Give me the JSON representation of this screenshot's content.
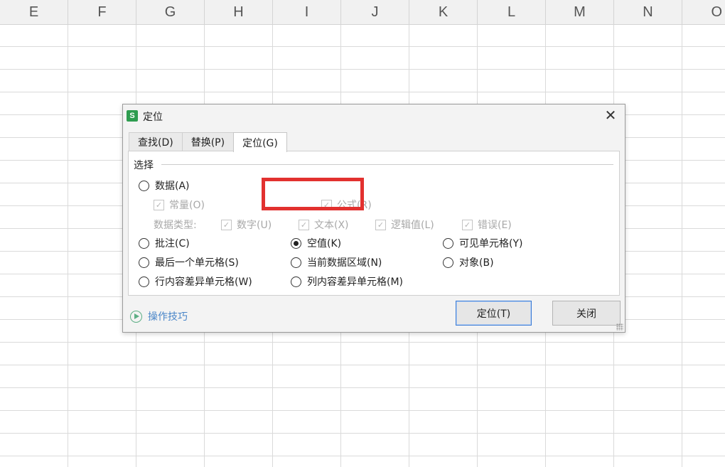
{
  "spreadsheet": {
    "columns": [
      "E",
      "F",
      "G",
      "H",
      "I",
      "J",
      "K",
      "L",
      "M",
      "N",
      "O"
    ]
  },
  "dialog": {
    "app_icon_letter": "S",
    "title": "定位",
    "close_glyph": "✕",
    "tabs": [
      {
        "label": "查找(D)",
        "active": false
      },
      {
        "label": "替换(P)",
        "active": false
      },
      {
        "label": "定位(G)",
        "active": true
      }
    ],
    "group_label": "选择",
    "options": {
      "data": "数据(A)",
      "constants": "常量(O)",
      "formulas": "公式(R)",
      "data_type_label": "数据类型:",
      "numbers": "数字(U)",
      "text": "文本(X)",
      "logical": "逻辑值(L)",
      "errors": "错误(E)",
      "comments": "批注(C)",
      "blanks": "空值(K)",
      "visible_cells": "可见单元格(Y)",
      "last_cell": "最后一个单元格(S)",
      "current_region": "当前数据区域(N)",
      "objects": "对象(B)",
      "row_differences": "行内容差异单元格(W)",
      "column_differences": "列内容差异单元格(M)"
    },
    "selected_option": "空值(K)",
    "tips_link": "操作技巧",
    "buttons": {
      "locate": "定位(T)",
      "close": "关闭"
    }
  },
  "colors": {
    "highlight_box": "#e2312f",
    "app_icon": "#2e9c4f",
    "link": "#4a86c8",
    "primary_border": "#3a7bd5"
  }
}
